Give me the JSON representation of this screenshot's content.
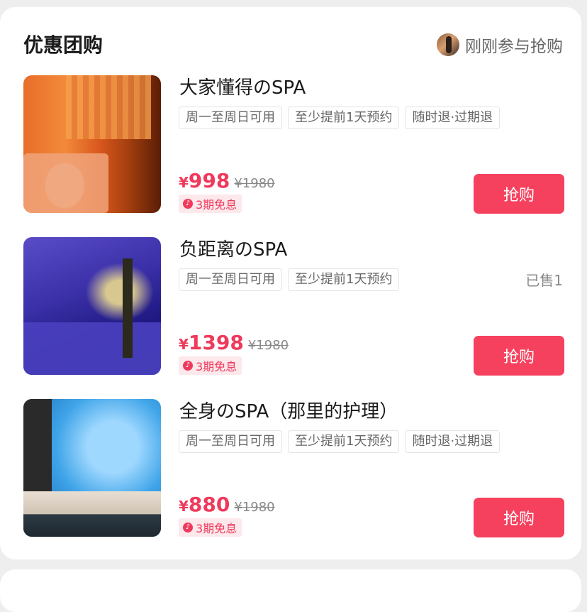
{
  "section": {
    "title": "优惠团购",
    "recent_label": "刚刚参与抢购"
  },
  "deals": [
    {
      "title": "大家懂得のSPA",
      "tags": [
        "周一至周日可用",
        "至少提前1天预约",
        "随时退·过期退"
      ],
      "sold": "",
      "currency": "¥",
      "price": "998",
      "original_price": "¥1980",
      "installment": "3期免息",
      "buy_label": "抢购"
    },
    {
      "title": "负距离のSPA",
      "tags": [
        "周一至周日可用",
        "至少提前1天预约"
      ],
      "sold": "已售1",
      "currency": "¥",
      "price": "1398",
      "original_price": "¥1980",
      "installment": "3期免息",
      "buy_label": "抢购"
    },
    {
      "title": "全身のSPA（那里的护理）",
      "tags": [
        "周一至周日可用",
        "至少提前1天预约",
        "随时退·过期退"
      ],
      "sold": "",
      "currency": "¥",
      "price": "880",
      "original_price": "¥1980",
      "installment": "3期免息",
      "buy_label": "抢购"
    }
  ],
  "colors": {
    "accent": "#f6415e",
    "price": "#ee3a5c",
    "badge_bg": "#fde8ec"
  }
}
